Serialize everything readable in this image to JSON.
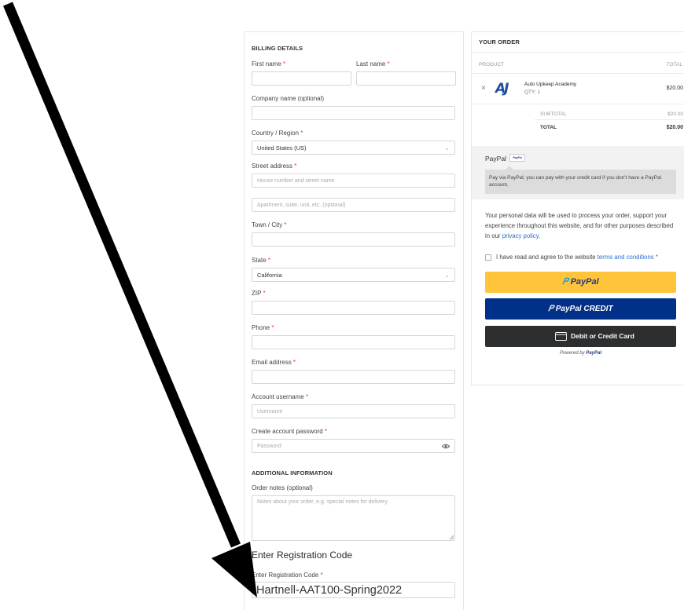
{
  "billing": {
    "title": "BILLING DETAILS",
    "first_name": "First name",
    "last_name": "Last name",
    "company": "Company name (optional)",
    "country_label": "Country / Region",
    "country_value": "United States (US)",
    "street_label": "Street address",
    "street_placeholder": "House number and street name",
    "apt_placeholder": "Apartment, suite, unit, etc. (optional)",
    "city_label": "Town / City",
    "state_label": "State",
    "state_value": "California",
    "zip_label": "ZIP",
    "phone_label": "Phone",
    "email_label": "Email address",
    "username_label": "Account username",
    "username_placeholder": "Username",
    "password_label": "Create account password",
    "password_placeholder": "Password",
    "required_mark": "*"
  },
  "additional": {
    "title": "ADDITIONAL INFORMATION",
    "notes_label": "Order notes (optional)",
    "notes_placeholder": "Notes about your order, e.g. special notes for delivery."
  },
  "registration": {
    "title": "Enter Registration Code",
    "label": "Enter Registration Code",
    "value": "Hartnell-AAT100-Spring2022"
  },
  "order": {
    "title": "YOUR ORDER",
    "col_product": "PRODUCT",
    "col_total": "TOTAL",
    "item_name": "Auto Upkeep Academy",
    "item_qty": "QTY: 1",
    "item_price": "$20.00",
    "logo_text": "AJ",
    "subtotal_label": "SUBTOTAL",
    "subtotal_value": "$20.00",
    "total_label": "TOTAL",
    "total_value": "$20.00",
    "remove_symbol": "×"
  },
  "payment": {
    "method": "PayPal",
    "badge": "PayPal",
    "description": "Pay via PayPal; you can pay with your credit card if you don't have a PayPal account.",
    "privacy_text": "Your personal data will be used to process your order, support your experience throughout this website, and for other purposes described in our",
    "privacy_link": "privacy policy",
    "terms_text": "I have read and agree to the website",
    "terms_link": "terms and conditions",
    "btn_paypal": "PayPal",
    "btn_credit": "PayPal CREDIT",
    "btn_card": "Debit or Credit Card",
    "powered_by": "Powered by",
    "powered_brand": "PayPal"
  },
  "colors": {
    "paypal_yellow": "#ffc439",
    "paypal_navy": "#003087",
    "card_dark": "#2c2e2f",
    "link_blue": "#2a6fd0",
    "required_red": "#e2401c"
  }
}
